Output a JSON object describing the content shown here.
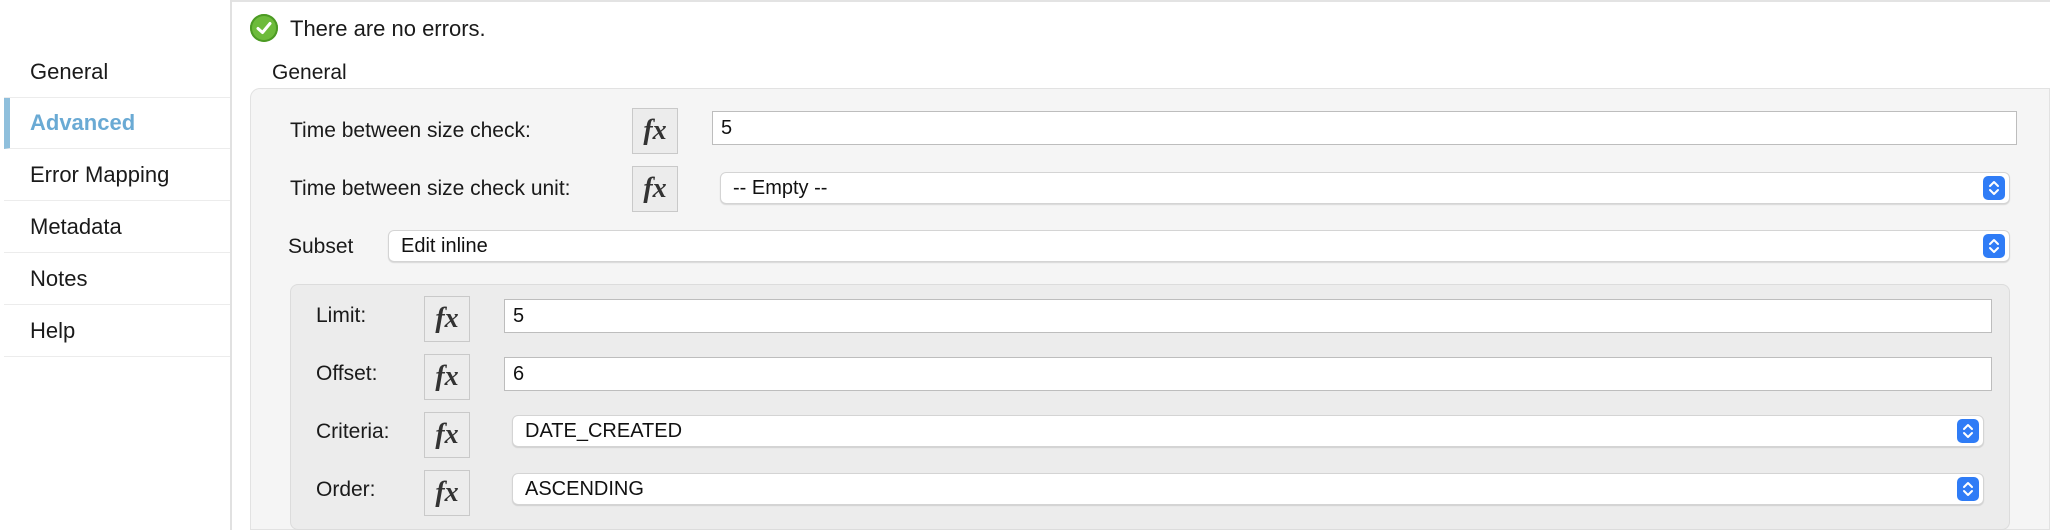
{
  "sidebar": {
    "items": [
      {
        "label": "General",
        "active": false
      },
      {
        "label": "Advanced",
        "active": true
      },
      {
        "label": "Error Mapping",
        "active": false
      },
      {
        "label": "Metadata",
        "active": false
      },
      {
        "label": "Notes",
        "active": false
      },
      {
        "label": "Help",
        "active": false
      }
    ]
  },
  "status": {
    "text": "There are no errors.",
    "icon": "check-circle-icon",
    "color": "#6dbb3b"
  },
  "section": {
    "title": "General"
  },
  "fx_label": "fx",
  "fields": {
    "time_between": {
      "label": "Time between size check:",
      "value": "5"
    },
    "time_unit": {
      "label": "Time between size check unit:",
      "value": "-- Empty --"
    },
    "subset": {
      "label": "Subset",
      "value": "Edit inline"
    },
    "limit": {
      "label": "Limit:",
      "value": "5"
    },
    "offset": {
      "label": "Offset:",
      "value": "6"
    },
    "criteria": {
      "label": "Criteria:",
      "value": "DATE_CREATED"
    },
    "order": {
      "label": "Order:",
      "value": "ASCENDING"
    }
  },
  "colors": {
    "accent": "#6aaad4",
    "select_stepper": "#2f7cf6",
    "panel": "#f5f5f5"
  }
}
